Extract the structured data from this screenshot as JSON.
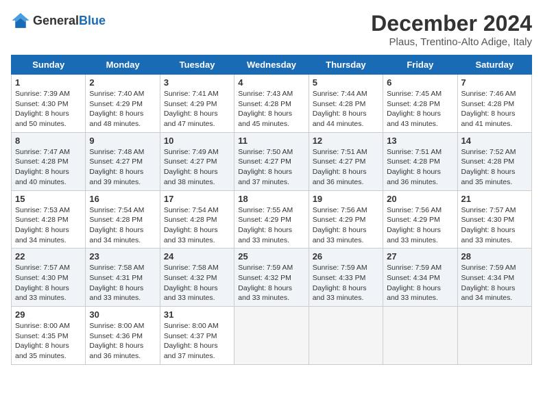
{
  "header": {
    "logo_general": "General",
    "logo_blue": "Blue",
    "title": "December 2024",
    "subtitle": "Plaus, Trentino-Alto Adige, Italy"
  },
  "columns": [
    "Sunday",
    "Monday",
    "Tuesday",
    "Wednesday",
    "Thursday",
    "Friday",
    "Saturday"
  ],
  "weeks": [
    [
      {
        "day": "1",
        "sunrise": "Sunrise: 7:39 AM",
        "sunset": "Sunset: 4:30 PM",
        "daylight": "Daylight: 8 hours and 50 minutes."
      },
      {
        "day": "2",
        "sunrise": "Sunrise: 7:40 AM",
        "sunset": "Sunset: 4:29 PM",
        "daylight": "Daylight: 8 hours and 48 minutes."
      },
      {
        "day": "3",
        "sunrise": "Sunrise: 7:41 AM",
        "sunset": "Sunset: 4:29 PM",
        "daylight": "Daylight: 8 hours and 47 minutes."
      },
      {
        "day": "4",
        "sunrise": "Sunrise: 7:43 AM",
        "sunset": "Sunset: 4:28 PM",
        "daylight": "Daylight: 8 hours and 45 minutes."
      },
      {
        "day": "5",
        "sunrise": "Sunrise: 7:44 AM",
        "sunset": "Sunset: 4:28 PM",
        "daylight": "Daylight: 8 hours and 44 minutes."
      },
      {
        "day": "6",
        "sunrise": "Sunrise: 7:45 AM",
        "sunset": "Sunset: 4:28 PM",
        "daylight": "Daylight: 8 hours and 43 minutes."
      },
      {
        "day": "7",
        "sunrise": "Sunrise: 7:46 AM",
        "sunset": "Sunset: 4:28 PM",
        "daylight": "Daylight: 8 hours and 41 minutes."
      }
    ],
    [
      {
        "day": "8",
        "sunrise": "Sunrise: 7:47 AM",
        "sunset": "Sunset: 4:28 PM",
        "daylight": "Daylight: 8 hours and 40 minutes."
      },
      {
        "day": "9",
        "sunrise": "Sunrise: 7:48 AM",
        "sunset": "Sunset: 4:27 PM",
        "daylight": "Daylight: 8 hours and 39 minutes."
      },
      {
        "day": "10",
        "sunrise": "Sunrise: 7:49 AM",
        "sunset": "Sunset: 4:27 PM",
        "daylight": "Daylight: 8 hours and 38 minutes."
      },
      {
        "day": "11",
        "sunrise": "Sunrise: 7:50 AM",
        "sunset": "Sunset: 4:27 PM",
        "daylight": "Daylight: 8 hours and 37 minutes."
      },
      {
        "day": "12",
        "sunrise": "Sunrise: 7:51 AM",
        "sunset": "Sunset: 4:27 PM",
        "daylight": "Daylight: 8 hours and 36 minutes."
      },
      {
        "day": "13",
        "sunrise": "Sunrise: 7:51 AM",
        "sunset": "Sunset: 4:28 PM",
        "daylight": "Daylight: 8 hours and 36 minutes."
      },
      {
        "day": "14",
        "sunrise": "Sunrise: 7:52 AM",
        "sunset": "Sunset: 4:28 PM",
        "daylight": "Daylight: 8 hours and 35 minutes."
      }
    ],
    [
      {
        "day": "15",
        "sunrise": "Sunrise: 7:53 AM",
        "sunset": "Sunset: 4:28 PM",
        "daylight": "Daylight: 8 hours and 34 minutes."
      },
      {
        "day": "16",
        "sunrise": "Sunrise: 7:54 AM",
        "sunset": "Sunset: 4:28 PM",
        "daylight": "Daylight: 8 hours and 34 minutes."
      },
      {
        "day": "17",
        "sunrise": "Sunrise: 7:54 AM",
        "sunset": "Sunset: 4:28 PM",
        "daylight": "Daylight: 8 hours and 33 minutes."
      },
      {
        "day": "18",
        "sunrise": "Sunrise: 7:55 AM",
        "sunset": "Sunset: 4:29 PM",
        "daylight": "Daylight: 8 hours and 33 minutes."
      },
      {
        "day": "19",
        "sunrise": "Sunrise: 7:56 AM",
        "sunset": "Sunset: 4:29 PM",
        "daylight": "Daylight: 8 hours and 33 minutes."
      },
      {
        "day": "20",
        "sunrise": "Sunrise: 7:56 AM",
        "sunset": "Sunset: 4:29 PM",
        "daylight": "Daylight: 8 hours and 33 minutes."
      },
      {
        "day": "21",
        "sunrise": "Sunrise: 7:57 AM",
        "sunset": "Sunset: 4:30 PM",
        "daylight": "Daylight: 8 hours and 33 minutes."
      }
    ],
    [
      {
        "day": "22",
        "sunrise": "Sunrise: 7:57 AM",
        "sunset": "Sunset: 4:30 PM",
        "daylight": "Daylight: 8 hours and 33 minutes."
      },
      {
        "day": "23",
        "sunrise": "Sunrise: 7:58 AM",
        "sunset": "Sunset: 4:31 PM",
        "daylight": "Daylight: 8 hours and 33 minutes."
      },
      {
        "day": "24",
        "sunrise": "Sunrise: 7:58 AM",
        "sunset": "Sunset: 4:32 PM",
        "daylight": "Daylight: 8 hours and 33 minutes."
      },
      {
        "day": "25",
        "sunrise": "Sunrise: 7:59 AM",
        "sunset": "Sunset: 4:32 PM",
        "daylight": "Daylight: 8 hours and 33 minutes."
      },
      {
        "day": "26",
        "sunrise": "Sunrise: 7:59 AM",
        "sunset": "Sunset: 4:33 PM",
        "daylight": "Daylight: 8 hours and 33 minutes."
      },
      {
        "day": "27",
        "sunrise": "Sunrise: 7:59 AM",
        "sunset": "Sunset: 4:34 PM",
        "daylight": "Daylight: 8 hours and 33 minutes."
      },
      {
        "day": "28",
        "sunrise": "Sunrise: 7:59 AM",
        "sunset": "Sunset: 4:34 PM",
        "daylight": "Daylight: 8 hours and 34 minutes."
      }
    ],
    [
      {
        "day": "29",
        "sunrise": "Sunrise: 8:00 AM",
        "sunset": "Sunset: 4:35 PM",
        "daylight": "Daylight: 8 hours and 35 minutes."
      },
      {
        "day": "30",
        "sunrise": "Sunrise: 8:00 AM",
        "sunset": "Sunset: 4:36 PM",
        "daylight": "Daylight: 8 hours and 36 minutes."
      },
      {
        "day": "31",
        "sunrise": "Sunrise: 8:00 AM",
        "sunset": "Sunset: 4:37 PM",
        "daylight": "Daylight: 8 hours and 37 minutes."
      },
      null,
      null,
      null,
      null
    ]
  ]
}
